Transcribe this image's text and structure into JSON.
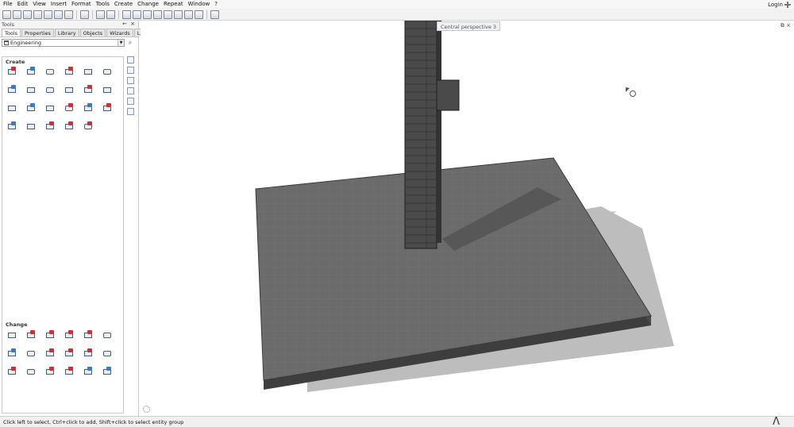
{
  "menu": [
    "File",
    "Edit",
    "View",
    "Insert",
    "Format",
    "Tools",
    "Create",
    "Change",
    "Repeat",
    "Window",
    "?"
  ],
  "login_label": "Login",
  "palette": {
    "title": "Tools",
    "pin": "←",
    "close": "×",
    "tabs": [
      "Tools",
      "Properties",
      "Library",
      "Objects",
      "Wizards",
      "Layers"
    ],
    "active_tab": "Tools",
    "category": "Engineering",
    "create_label": "Create",
    "change_label": "Change"
  },
  "viewport": {
    "view_label": "Central perspective 3",
    "controls": "⧉ ×"
  },
  "status": {
    "hint": "Click left to select, Ctrl+click to add, Shift+click to select entity group",
    "caret": "Λ"
  },
  "icons": {
    "pin": "pin-icon",
    "close": "close-icon",
    "search": "search-icon",
    "gear": "gear-icon",
    "cursor": "cursor-icon"
  }
}
